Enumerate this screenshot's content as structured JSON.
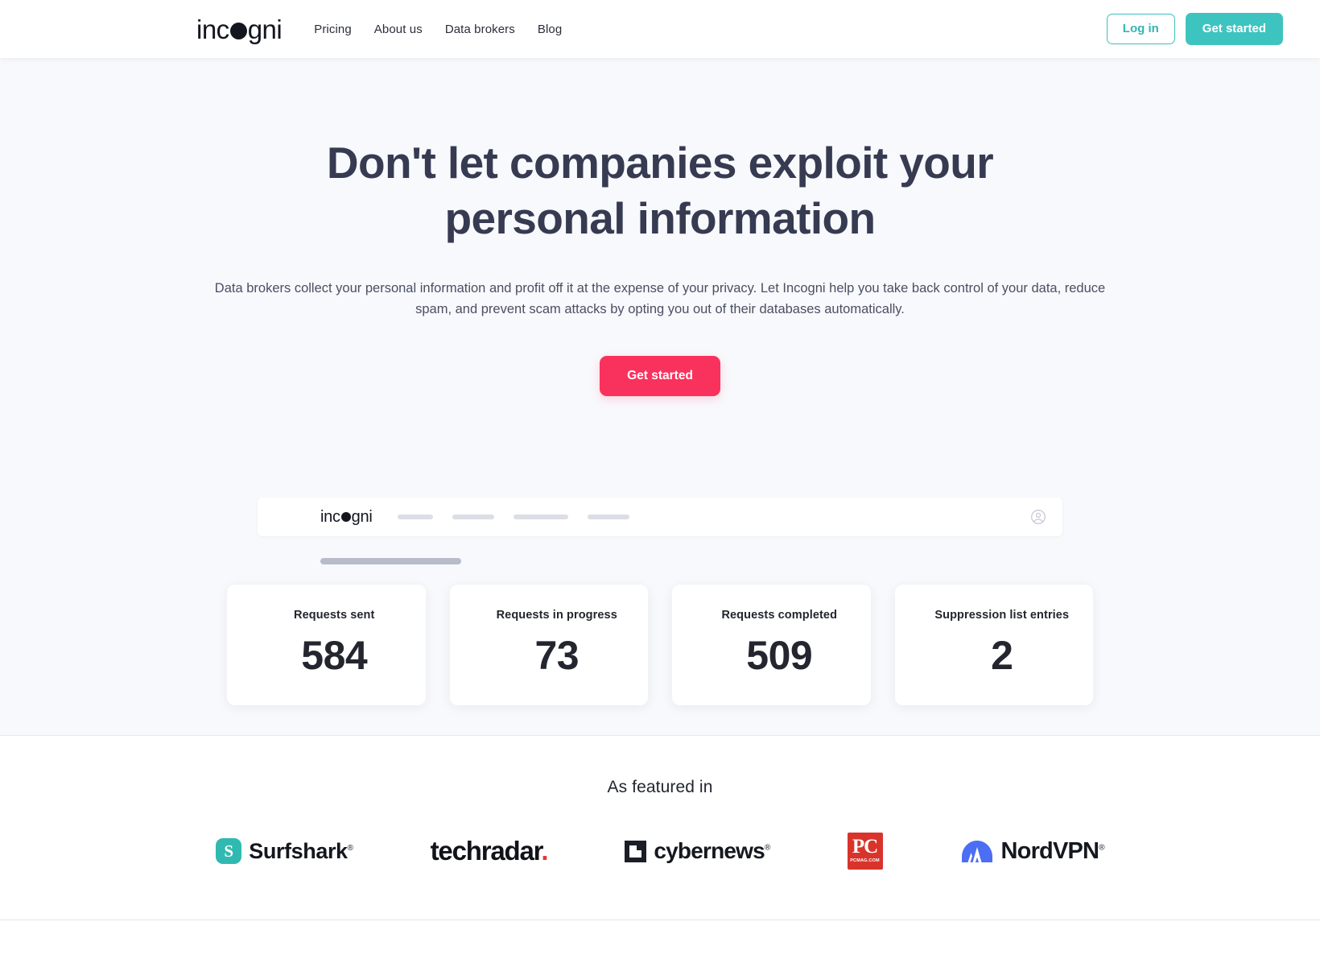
{
  "header": {
    "brand": {
      "pre": "inc",
      "dot": "o",
      "post": "gni",
      "name": "incogni"
    },
    "nav": [
      {
        "label": "Pricing"
      },
      {
        "label": "About us"
      },
      {
        "label": "Data brokers"
      },
      {
        "label": "Blog"
      }
    ],
    "login_label": "Log in",
    "get_started_label": "Get started",
    "accent_teal": "#3ec4c0"
  },
  "hero": {
    "heading": "Don't let companies exploit your personal information",
    "subheading": "Data brokers collect your personal information and profit off it at the expense of your privacy. Let Incogni help you take back control of your data, reduce spam, and prevent scam attacks by opting you out of their databases automatically.",
    "cta_label": "Get started",
    "cta_color": "#f9325d",
    "background": "#f8f9fc"
  },
  "mock_app": {
    "logo": {
      "pre": "inc",
      "post": "gni"
    },
    "nav_placeholder_widths": [
      44,
      52,
      68,
      52
    ],
    "avatar_icon": "user-circle-icon"
  },
  "stats": [
    {
      "label": "Requests sent",
      "value": "584"
    },
    {
      "label": "Requests in progress",
      "value": "73"
    },
    {
      "label": "Requests completed",
      "value": "509"
    },
    {
      "label": "Suppression list entries",
      "value": "2"
    }
  ],
  "featured": {
    "title": "As featured in",
    "logos": [
      {
        "name": "Surfshark",
        "mark": "surfshark-icon",
        "sup": "®"
      },
      {
        "name": "techradar",
        "mark": "techradar-wordmark",
        "sup": "."
      },
      {
        "name": "cybernews",
        "mark": "cybernews-icon",
        "sup": "®"
      },
      {
        "name": "PC",
        "sub": "PCMAG.COM",
        "mark": "pcmag-icon"
      },
      {
        "name": "NordVPN",
        "mark": "nordvpn-icon",
        "sup": "®"
      }
    ]
  }
}
